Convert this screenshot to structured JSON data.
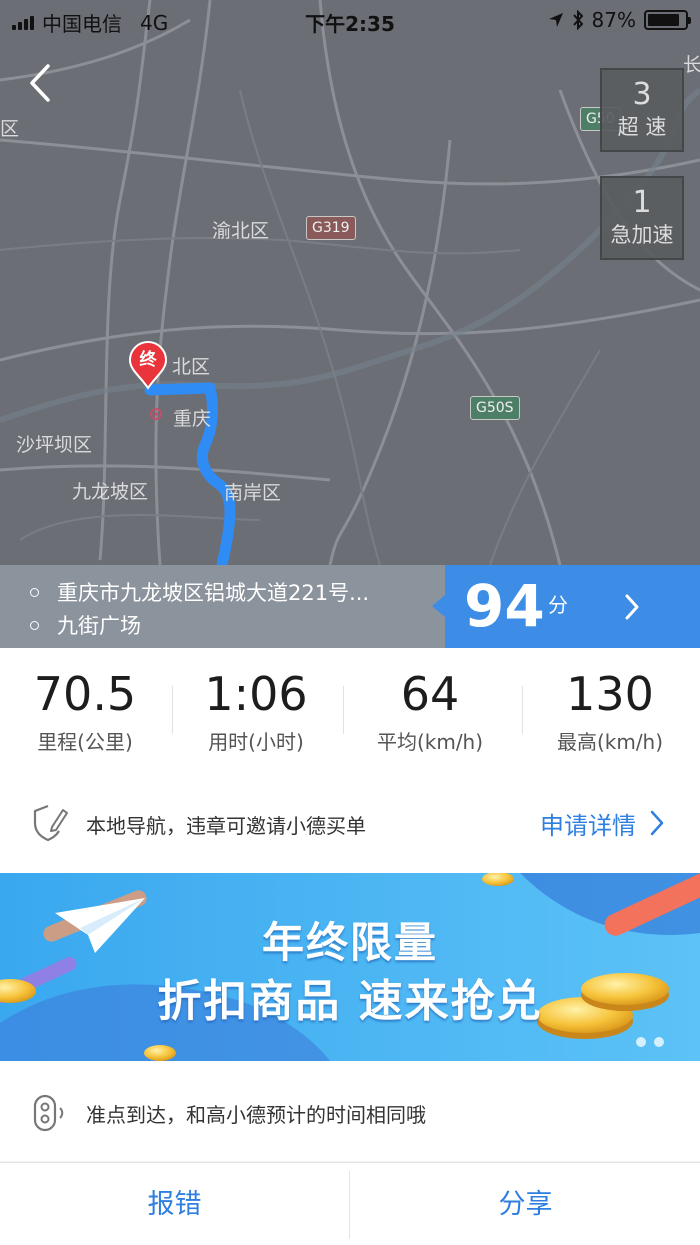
{
  "status_bar": {
    "carrier": "中国电信",
    "network": "4G",
    "time": "下午2:35",
    "battery": "87%",
    "battery_level": 0.87
  },
  "map": {
    "labels": {
      "l1": "区",
      "l2": "渝北区",
      "l3": "北区",
      "l4": "重庆",
      "l5": "沙坪坝区",
      "l6": "九龙坡区",
      "l7": "南岸区",
      "l8": "长"
    },
    "roads": {
      "r1": "G319",
      "r2": "G50S",
      "r3": "G50"
    },
    "end_marker": "终"
  },
  "events": {
    "speeding": {
      "count": "3",
      "label": "超 速"
    },
    "accel": {
      "count": "1",
      "label": "急加速"
    }
  },
  "route": {
    "start": "重庆市九龙坡区铝城大道221号...",
    "end": "九街广场"
  },
  "score": {
    "value": "94",
    "unit": "分"
  },
  "stats": [
    {
      "value": "70.5",
      "label": "里程(公里)"
    },
    {
      "value": "1:06",
      "label": "用时(小时)"
    },
    {
      "value": "64",
      "label": "平均(km/h)"
    },
    {
      "value": "130",
      "label": "最高(km/h)"
    }
  ],
  "nav_info": {
    "text": "本地导航，违章可邀请小德买单",
    "link": "申请详情"
  },
  "banner": {
    "line1": "年终限量",
    "line2": "折扣商品 速来抢兑"
  },
  "tip": {
    "text": "准点到达，和高小德预计的时间相同哦"
  },
  "bottom": {
    "report": "报错",
    "share": "分享"
  },
  "colors": {
    "accent": "#3d8de6",
    "map_bg": "#6b6e75",
    "route": "#2f8cf4",
    "marker": "#e8343a"
  }
}
